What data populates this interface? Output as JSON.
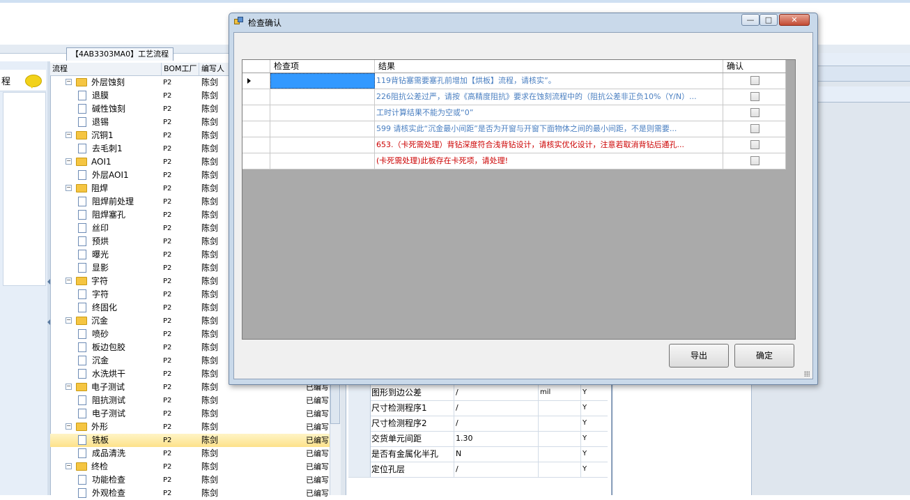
{
  "background": {
    "process_tab_label": "【4AB3303MA0】工艺流程",
    "left_panel_label": "程",
    "tree_columns": [
      "流程",
      "BOM工厂",
      "编写人"
    ],
    "tree_rows": [
      {
        "type": "folder",
        "name": "外层蚀刻",
        "bom": "P2",
        "author": "陈剑",
        "status": ""
      },
      {
        "type": "doc",
        "name": "退膜",
        "bom": "P2",
        "author": "陈剑",
        "status": ""
      },
      {
        "type": "doc",
        "name": "碱性蚀刻",
        "bom": "P2",
        "author": "陈剑",
        "status": ""
      },
      {
        "type": "doc",
        "name": "退锡",
        "bom": "P2",
        "author": "陈剑",
        "status": ""
      },
      {
        "type": "folder",
        "name": "沉铜1",
        "bom": "P2",
        "author": "陈剑",
        "status": ""
      },
      {
        "type": "doc",
        "name": "去毛刺1",
        "bom": "P2",
        "author": "陈剑",
        "status": ""
      },
      {
        "type": "folder",
        "name": "AOI1",
        "bom": "P2",
        "author": "陈剑",
        "status": ""
      },
      {
        "type": "doc",
        "name": "外层AOI1",
        "bom": "P2",
        "author": "陈剑",
        "status": ""
      },
      {
        "type": "folder",
        "name": "阻焊",
        "bom": "P2",
        "author": "陈剑",
        "status": ""
      },
      {
        "type": "doc",
        "name": "阻焊前处理",
        "bom": "P2",
        "author": "陈剑",
        "status": ""
      },
      {
        "type": "doc",
        "name": "阻焊塞孔",
        "bom": "P2",
        "author": "陈剑",
        "status": ""
      },
      {
        "type": "doc",
        "name": "丝印",
        "bom": "P2",
        "author": "陈剑",
        "status": ""
      },
      {
        "type": "doc",
        "name": "预烘",
        "bom": "P2",
        "author": "陈剑",
        "status": ""
      },
      {
        "type": "doc",
        "name": "曝光",
        "bom": "P2",
        "author": "陈剑",
        "status": ""
      },
      {
        "type": "doc",
        "name": "显影",
        "bom": "P2",
        "author": "陈剑",
        "status": ""
      },
      {
        "type": "folder",
        "name": "字符",
        "bom": "P2",
        "author": "陈剑",
        "status": ""
      },
      {
        "type": "doc",
        "name": "字符",
        "bom": "P2",
        "author": "陈剑",
        "status": ""
      },
      {
        "type": "doc",
        "name": "终固化",
        "bom": "P2",
        "author": "陈剑",
        "status": ""
      },
      {
        "type": "folder",
        "name": "沉金",
        "bom": "P2",
        "author": "陈剑",
        "status": ""
      },
      {
        "type": "doc",
        "name": "喷砂",
        "bom": "P2",
        "author": "陈剑",
        "status": ""
      },
      {
        "type": "doc",
        "name": "板边包胶",
        "bom": "P2",
        "author": "陈剑",
        "status": ""
      },
      {
        "type": "doc",
        "name": "沉金",
        "bom": "P2",
        "author": "陈剑",
        "status": ""
      },
      {
        "type": "doc",
        "name": "水洗烘干",
        "bom": "P2",
        "author": "陈剑",
        "status": ""
      },
      {
        "type": "folder",
        "name": "电子测试",
        "bom": "P2",
        "author": "陈剑",
        "status": "已编写"
      },
      {
        "type": "doc",
        "name": "阻抗测试",
        "bom": "P2",
        "author": "陈剑",
        "status": "已编写"
      },
      {
        "type": "doc",
        "name": "电子测试",
        "bom": "P2",
        "author": "陈剑",
        "status": "已编写"
      },
      {
        "type": "folder",
        "name": "外形",
        "bom": "P2",
        "author": "陈剑",
        "status": "已编写"
      },
      {
        "type": "doc",
        "name": "铣板",
        "bom": "P2",
        "author": "陈剑",
        "status": "已编写",
        "selected": true
      },
      {
        "type": "doc",
        "name": "成品清洗",
        "bom": "P2",
        "author": "陈剑",
        "status": "已编写"
      },
      {
        "type": "folder",
        "name": "终检",
        "bom": "P2",
        "author": "陈剑",
        "status": "已编写"
      },
      {
        "type": "doc",
        "name": "功能检查",
        "bom": "P2",
        "author": "陈剑",
        "status": "已编写"
      },
      {
        "type": "doc",
        "name": "外观检查",
        "bom": "P2",
        "author": "陈剑",
        "status": "已编写"
      }
    ],
    "properties": [
      {
        "name": "图形到边公差",
        "value": "/",
        "unit": "mil",
        "flag": "Y"
      },
      {
        "name": "尺寸检测程序1",
        "value": "/",
        "unit": "",
        "flag": "Y"
      },
      {
        "name": "尺寸检测程序2",
        "value": "/",
        "unit": "",
        "flag": "Y"
      },
      {
        "name": "交货单元间距",
        "value": "1.30",
        "unit": "",
        "flag": "Y"
      },
      {
        "name": "是否有金属化半孔",
        "value": "N",
        "unit": "",
        "flag": "Y"
      },
      {
        "name": "定位孔层",
        "value": "/",
        "unit": "",
        "flag": "Y"
      }
    ]
  },
  "dialog": {
    "title": "检查确认",
    "window_buttons": {
      "minimize": "—",
      "maximize": "□",
      "close": "✕"
    },
    "columns": {
      "item": "检查项",
      "result": "结果",
      "confirm": "确认"
    },
    "rows": [
      {
        "item": "",
        "result": "119背钻塞需要塞孔前增加【烘板】流程，请核实”。",
        "color": "#4a7fc1",
        "checked": false,
        "selected": true
      },
      {
        "item": "",
        "result": "226阻抗公差过严，请按《高精度阻抗》要求在蚀刻流程中的（阻抗公差非正负10%（Y/N）...",
        "color": "#4a7fc1",
        "checked": false
      },
      {
        "item": "",
        "result": "工时计算结果不能为空或“0”",
        "color": "#4a7fc1",
        "checked": false
      },
      {
        "item": "",
        "result": "599 请核实此“沉金最小间距”是否为开窗与开窗下面物体之间的最小间距，不是则需要...",
        "color": "#4a7fc1",
        "checked": false
      },
      {
        "item": "",
        "result": "653.（卡死需处理）背钻深度符合浅背钻设计，请核实优化设计，注意若取消背钻后通孔...",
        "color": "#cc0000",
        "checked": false
      },
      {
        "item": "",
        "result": "(卡死需处理)此板存在卡死项，请处理!",
        "color": "#cc0000",
        "checked": false
      }
    ],
    "buttons": {
      "export": "导出",
      "ok": "确定"
    }
  },
  "colors": {
    "accent": "#3399ff",
    "warning": "#cc0000",
    "info": "#4a7fc1",
    "tree_selected": "#fde28a"
  }
}
